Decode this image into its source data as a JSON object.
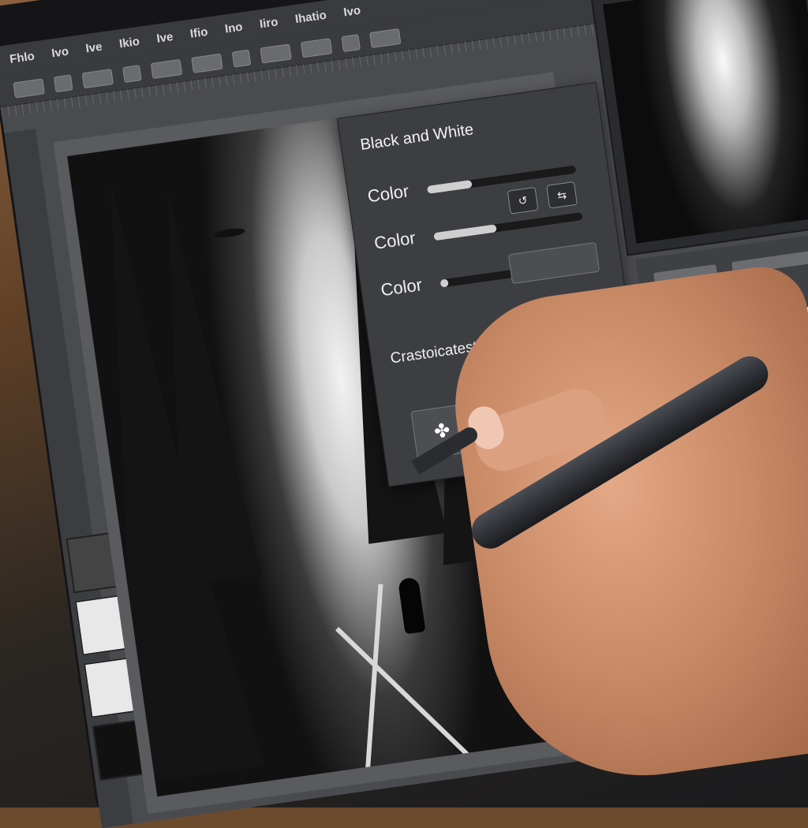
{
  "menu": [
    "Fhlo",
    "Ivo",
    "Ive",
    "Ikio",
    "Ive",
    "Ifio",
    "Ino",
    "Iiro",
    "Ihatio",
    "Ivo"
  ],
  "panel": {
    "title": "Black and White",
    "rows": [
      {
        "label": "Color",
        "value": 0.3
      },
      {
        "label": "Color",
        "value": 0.42
      },
      {
        "label": "Color",
        "value": 0.05
      }
    ],
    "button_a": "↺",
    "button_b": "⇆",
    "section_label": "Crastoicatest",
    "box_icon": "✤"
  }
}
